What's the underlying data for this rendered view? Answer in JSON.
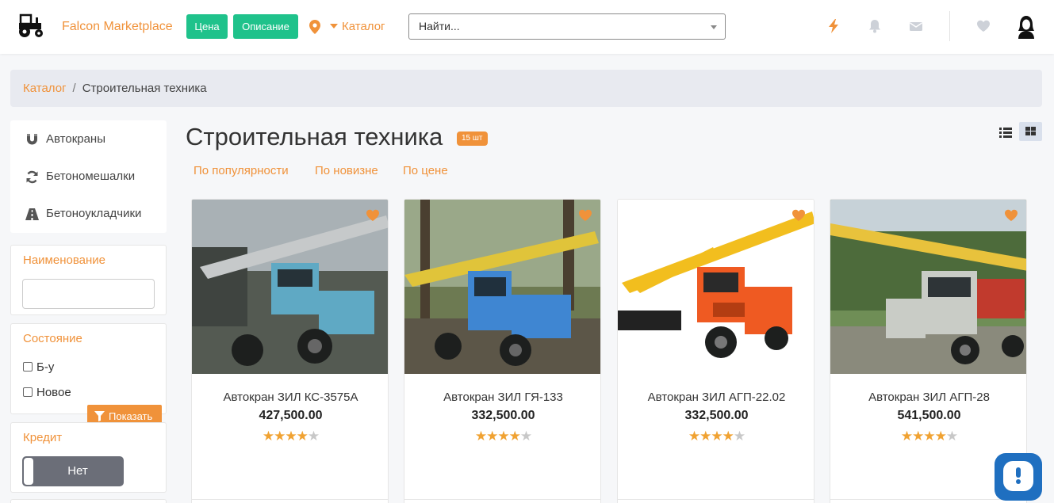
{
  "header": {
    "brand": "Falcon Marketplace",
    "pill_price": "Цена",
    "pill_description": "Описание",
    "catalog_label": "Каталог",
    "search_placeholder": "Найти..."
  },
  "breadcrumb": {
    "root": "Каталог",
    "separator": "/",
    "current": "Строительная техника"
  },
  "sidebar": {
    "categories": [
      {
        "label": "Автокраны",
        "icon": "magnet-icon"
      },
      {
        "label": "Бетономешалки",
        "icon": "refresh-icon"
      },
      {
        "label": "Бетоноукладчики",
        "icon": "road-icon"
      }
    ],
    "name_filter": {
      "title": "Наименование",
      "value": ""
    },
    "condition_filter": {
      "title": "Состояние",
      "options": [
        {
          "label": "Б-у",
          "checked": false
        },
        {
          "label": "Новое",
          "checked": false
        }
      ]
    },
    "show_button": "Показать",
    "credit_filter": {
      "title": "Кредит",
      "toggle_label": "Нет"
    }
  },
  "main": {
    "title": "Строительная техника",
    "count_badge": "15 шт",
    "sort_options": [
      "По популярности",
      "По новизне",
      "По цене"
    ]
  },
  "products": [
    {
      "name": "Автокран ЗИЛ КС-3575А",
      "price": "427,500.00",
      "rating": 4,
      "max_rating": 5,
      "cab_color": "#5fa9c4",
      "boom_color": "#b9bcbd"
    },
    {
      "name": "Автокран ЗИЛ ГЯ-133",
      "price": "332,500.00",
      "rating": 4,
      "max_rating": 5,
      "cab_color": "#3f86d2",
      "boom_color": "#e0c43a"
    },
    {
      "name": "Автокран ЗИЛ АГП-22.02",
      "price": "332,500.00",
      "rating": 4,
      "max_rating": 5,
      "cab_color": "#ef5a22",
      "boom_color": "#f2be1e"
    },
    {
      "name": "Автокран ЗИЛ АГП-28",
      "price": "541,500.00",
      "rating": 4,
      "max_rating": 5,
      "cab_color": "#c9ccc6",
      "boom_color": "#e8c23c"
    }
  ],
  "colors": {
    "accent": "#f0923a",
    "green": "#1fc28b",
    "chat_blue": "#1f6fc0"
  }
}
